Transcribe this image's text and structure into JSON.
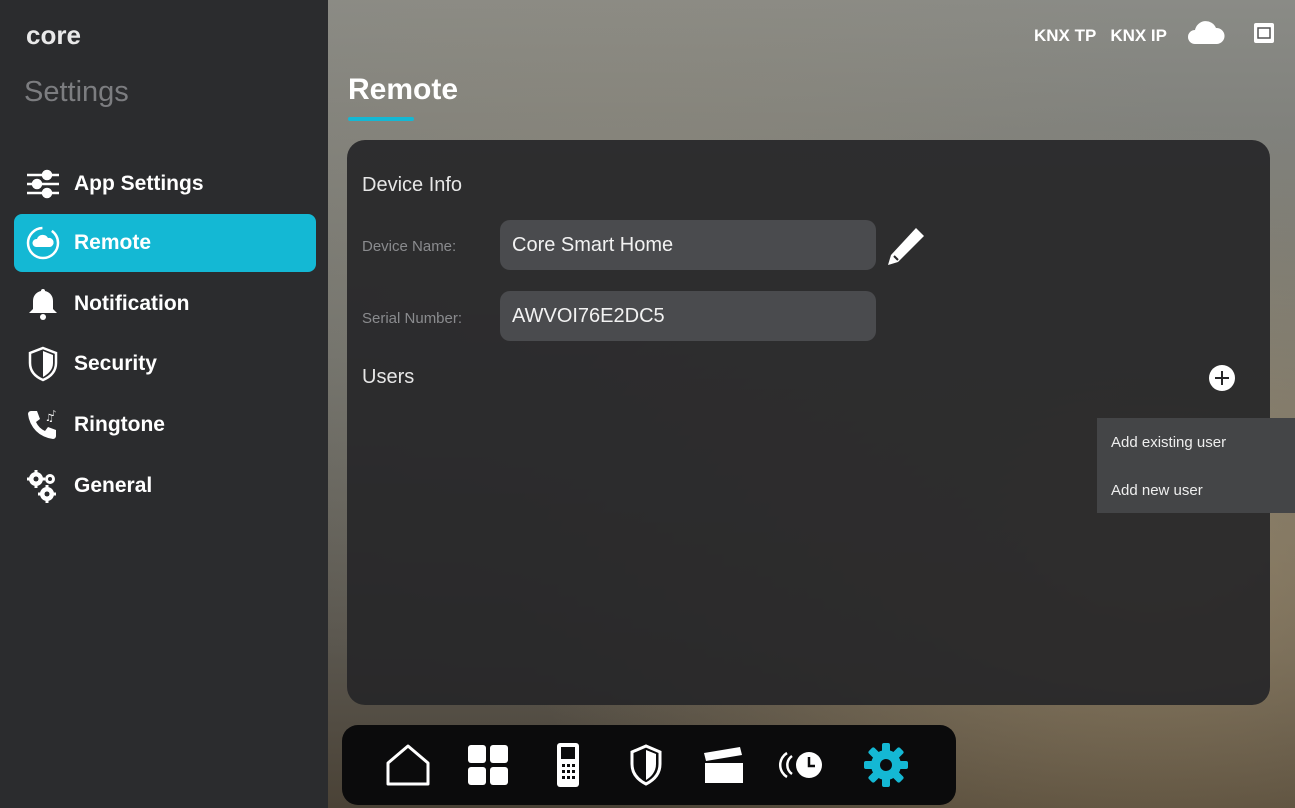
{
  "app": {
    "logo": "core"
  },
  "sidebar": {
    "title": "Settings",
    "items": [
      {
        "label": "App Settings",
        "icon": "sliders-icon",
        "active": false
      },
      {
        "label": "Remote",
        "icon": "cloud-remote-icon",
        "active": true
      },
      {
        "label": "Notification",
        "icon": "bell-icon",
        "active": false
      },
      {
        "label": "Security",
        "icon": "shield-icon",
        "active": false
      },
      {
        "label": "Ringtone",
        "icon": "phone-music-icon",
        "active": false
      },
      {
        "label": "General",
        "icon": "gears-icon",
        "active": false
      }
    ]
  },
  "topbar": {
    "knx_tp": "KNX TP",
    "knx_ip": "KNX IP",
    "icons": [
      "cloud-icon",
      "window-icon"
    ]
  },
  "page": {
    "title": "Remote"
  },
  "device_info": {
    "heading": "Device Info",
    "device_name_label": "Device Name:",
    "device_name_value": "Core Smart Home",
    "serial_label": "Serial Number:",
    "serial_value": "AWVOI76E2DC5"
  },
  "users": {
    "heading": "Users",
    "menu": [
      "Add existing user",
      "Add new user"
    ]
  },
  "bottom_nav": {
    "items": [
      "home-icon",
      "grid-icon",
      "intercom-icon",
      "shield-icon",
      "clapperboard-icon",
      "timer-icon",
      "settings-gear-icon"
    ],
    "active": "settings-gear-icon"
  },
  "colors": {
    "accent": "#14b8d4",
    "sidebar": "#2b2c2e",
    "panel": "#262628"
  }
}
